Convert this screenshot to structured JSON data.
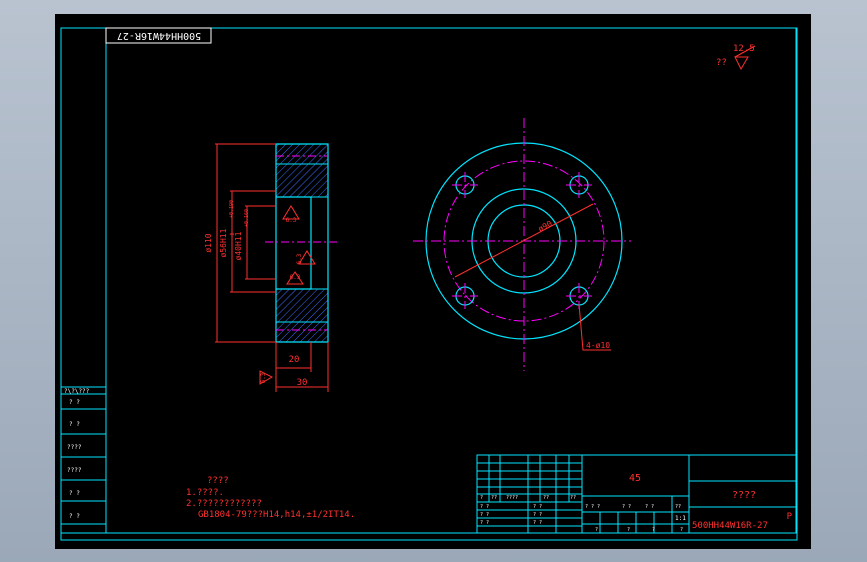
{
  "title_block": {
    "drawing_number_rotated": "500HH44W16R-27",
    "drawing_number": "500HH44W16R-27",
    "material": "45",
    "part_name": "????",
    "sheet_code": "P",
    "scale": "1:1"
  },
  "roughness": {
    "corner_note": "??",
    "corner_value": "12.5",
    "section_top": "6.3",
    "section_mid": "6.3",
    "section_low": "6.3",
    "bottom_left": "6.3"
  },
  "section_view": {
    "dim_outer": "ø110",
    "dim_middle": "ø56H11",
    "dim_inner": "ø40H11",
    "tol_middle": "+0.190",
    "tol_inner": "+0.160",
    "tol_zero": "0",
    "dim_width_small": "20",
    "dim_width_total": "30"
  },
  "plan_view": {
    "dim_pcd": "ø90",
    "hole_callout": "4-ø10"
  },
  "notes": {
    "heading": "????",
    "line1": "1.????.",
    "line2": "2.????????????",
    "line3": "GB1804-79???H14,h14,±1/2IT14."
  },
  "side_table": [
    "?\\?\\???",
    "?  ?",
    "?  ?",
    "????",
    "????",
    "?  ?",
    "?  ?"
  ],
  "grid_labels": {
    "header": [
      "?",
      "??",
      "????",
      "??",
      "??"
    ],
    "rows": [
      "?  ?",
      "?  ?",
      "?  ?"
    ],
    "row2": [
      "?  ?  ?",
      "?  ?",
      "?  ?",
      "??"
    ],
    "row3": [
      "?",
      "?",
      "?",
      "?"
    ]
  }
}
